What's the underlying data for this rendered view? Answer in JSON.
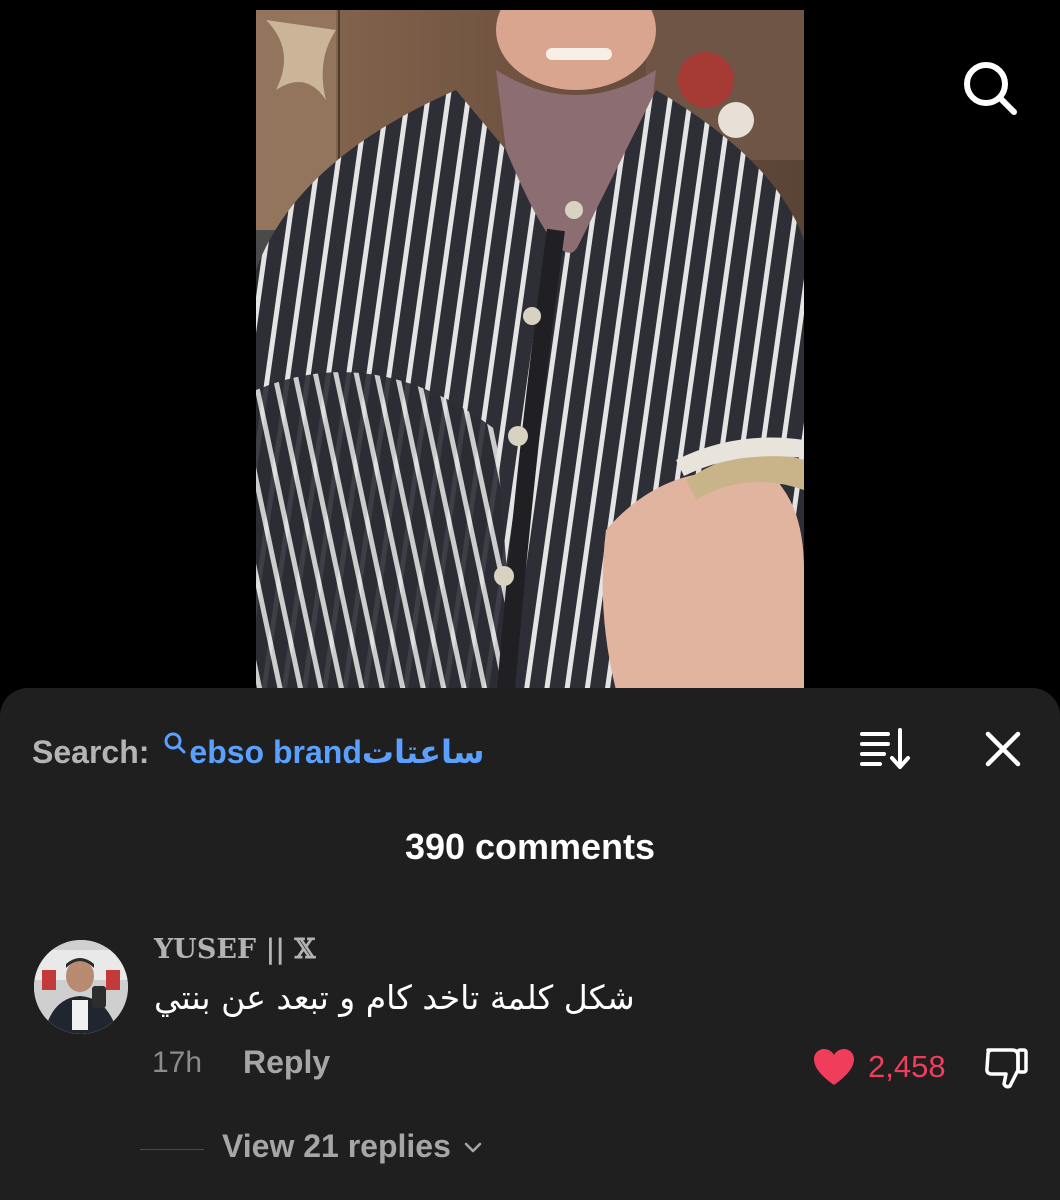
{
  "colors": {
    "background": "#000000",
    "sheet": "#1f1f1f",
    "link": "#5aa1ff",
    "like": "#f03d5c",
    "muted_text": "#a6a6a6",
    "primary_text": "#ffffff"
  },
  "header": {
    "search_icon": "search-icon"
  },
  "video": {
    "description": "video-thumbnail-icon"
  },
  "search_bar": {
    "prefix": "Search:",
    "query": "ساعتاتebso brand",
    "icons": {
      "mini_search": "mini-search-icon",
      "sort": "sort-icon",
      "close": "close-icon"
    }
  },
  "comments": {
    "count_label": "390 comments",
    "items": [
      {
        "author": "YUSEF || 𝕏",
        "text": "شكل كلمة تاخد كام و تبعد عن بنتي",
        "time": "17h",
        "reply_label": "Reply",
        "like_count": "2,458",
        "liked": true,
        "view_replies_label": "View 21 replies"
      }
    ]
  }
}
